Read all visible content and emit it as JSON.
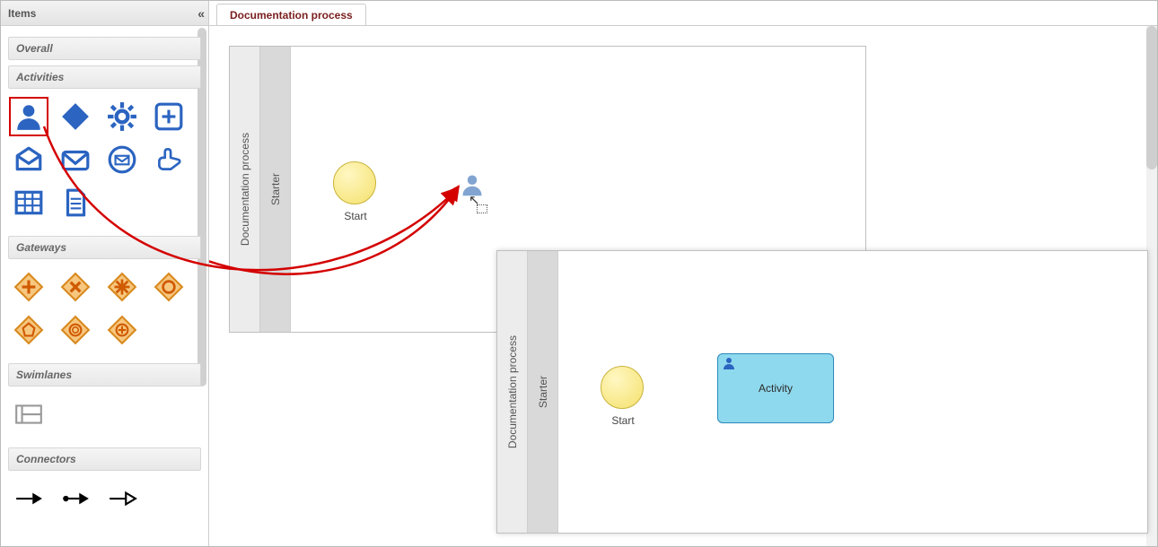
{
  "sidebar": {
    "title": "Items",
    "groups": {
      "overall": "Overall",
      "activities": "Activities",
      "gateways": "Gateways",
      "swimlanes": "Swimlanes",
      "connectors": "Connectors"
    }
  },
  "tab": {
    "label": "Documentation process"
  },
  "pool": {
    "title": "Documentation process",
    "lane": "Starter",
    "start_label": "Start"
  },
  "result_pool": {
    "title": "Documentation process",
    "lane": "Starter",
    "start_label": "Start",
    "activity_label": "Activity"
  },
  "colors": {
    "blue": "#2b64c1",
    "orange": "#e8902d",
    "teal": "#8fd9ee",
    "red": "#d40000"
  },
  "icons": {
    "user": "user-icon",
    "diamond": "diamond-icon",
    "gear": "gear-icon",
    "plus": "plus-box-icon",
    "mail_open": "mail-open-icon",
    "mail": "mail-icon",
    "mail_circle": "mail-circle-icon",
    "hand": "hand-point-icon",
    "grid": "grid-icon",
    "doc": "document-icon",
    "gw_plus": "gateway-parallel-icon",
    "gw_x": "gateway-exclusive-icon",
    "gw_star": "gateway-complex-icon",
    "gw_circle": "gateway-inclusive-icon",
    "gw_pent": "gateway-event-icon",
    "gw_hex": "gateway-event-parallel-icon",
    "gw_plus2": "gateway-parallel-event-icon",
    "lane": "swimlane-icon",
    "arrow_solid": "sequence-flow-icon",
    "arrow_cond": "conditional-flow-icon",
    "arrow_open": "message-flow-icon"
  }
}
